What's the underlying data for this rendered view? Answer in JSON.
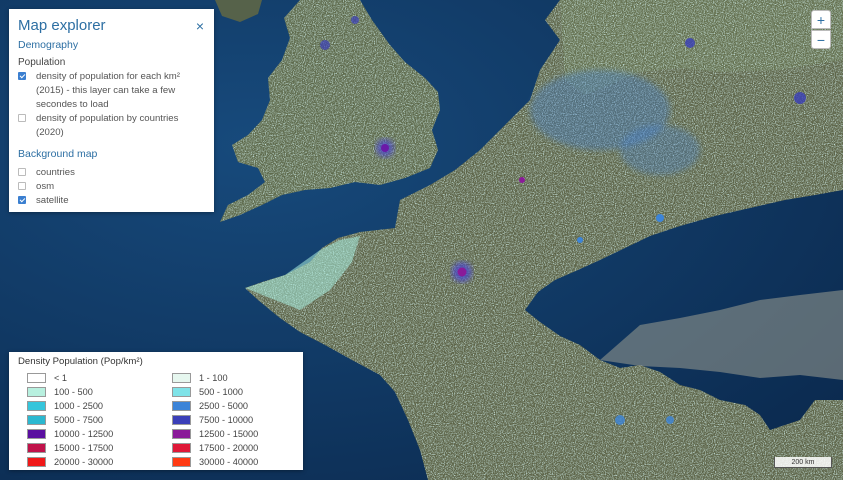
{
  "explorer": {
    "title": "Map explorer",
    "close_symbol": "×",
    "demography_title": "Demography",
    "population_title": "Population",
    "options": [
      {
        "label": "density of population for each km² (2015) - this layer can take a few secondes to load",
        "checked": true
      },
      {
        "label": "density of population by countries (2020)",
        "checked": false
      }
    ],
    "background_title": "Background map",
    "background_options": [
      {
        "label": "countries",
        "checked": false
      },
      {
        "label": "osm",
        "checked": false
      },
      {
        "label": "satellite",
        "checked": true
      }
    ]
  },
  "legend": {
    "title": "Density Population (Pop/km²)",
    "items": [
      {
        "label": "< 1",
        "color": "#ffffff"
      },
      {
        "label": "1 - 100",
        "color": "#e6f7ef"
      },
      {
        "label": "100 - 500",
        "color": "#b8f0df"
      },
      {
        "label": "500 - 1000",
        "color": "#7fe3e8"
      },
      {
        "label": "1000 - 2500",
        "color": "#35c5db"
      },
      {
        "label": "2500 - 5000",
        "color": "#3c84d8"
      },
      {
        "label": "5000 - 7500",
        "color": "#2bb8d0"
      },
      {
        "label": "7500 - 10000",
        "color": "#3a3fb8"
      },
      {
        "label": "10000 - 12500",
        "color": "#5a0fa0"
      },
      {
        "label": "12500 - 15000",
        "color": "#8a1a99"
      },
      {
        "label": "15000 - 17500",
        "color": "#c0124a"
      },
      {
        "label": "17500 - 20000",
        "color": "#df1838"
      },
      {
        "label": "20000 - 30000",
        "color": "#f01818"
      },
      {
        "label": "30000 - 40000",
        "color": "#ff3a12"
      }
    ]
  },
  "controls": {
    "zoom_in": "+",
    "zoom_out": "−",
    "scale_label": "200 km"
  },
  "colors": {
    "sea": "#0f3560",
    "land_base": "#5d6448",
    "accent": "#2d6fa3"
  }
}
